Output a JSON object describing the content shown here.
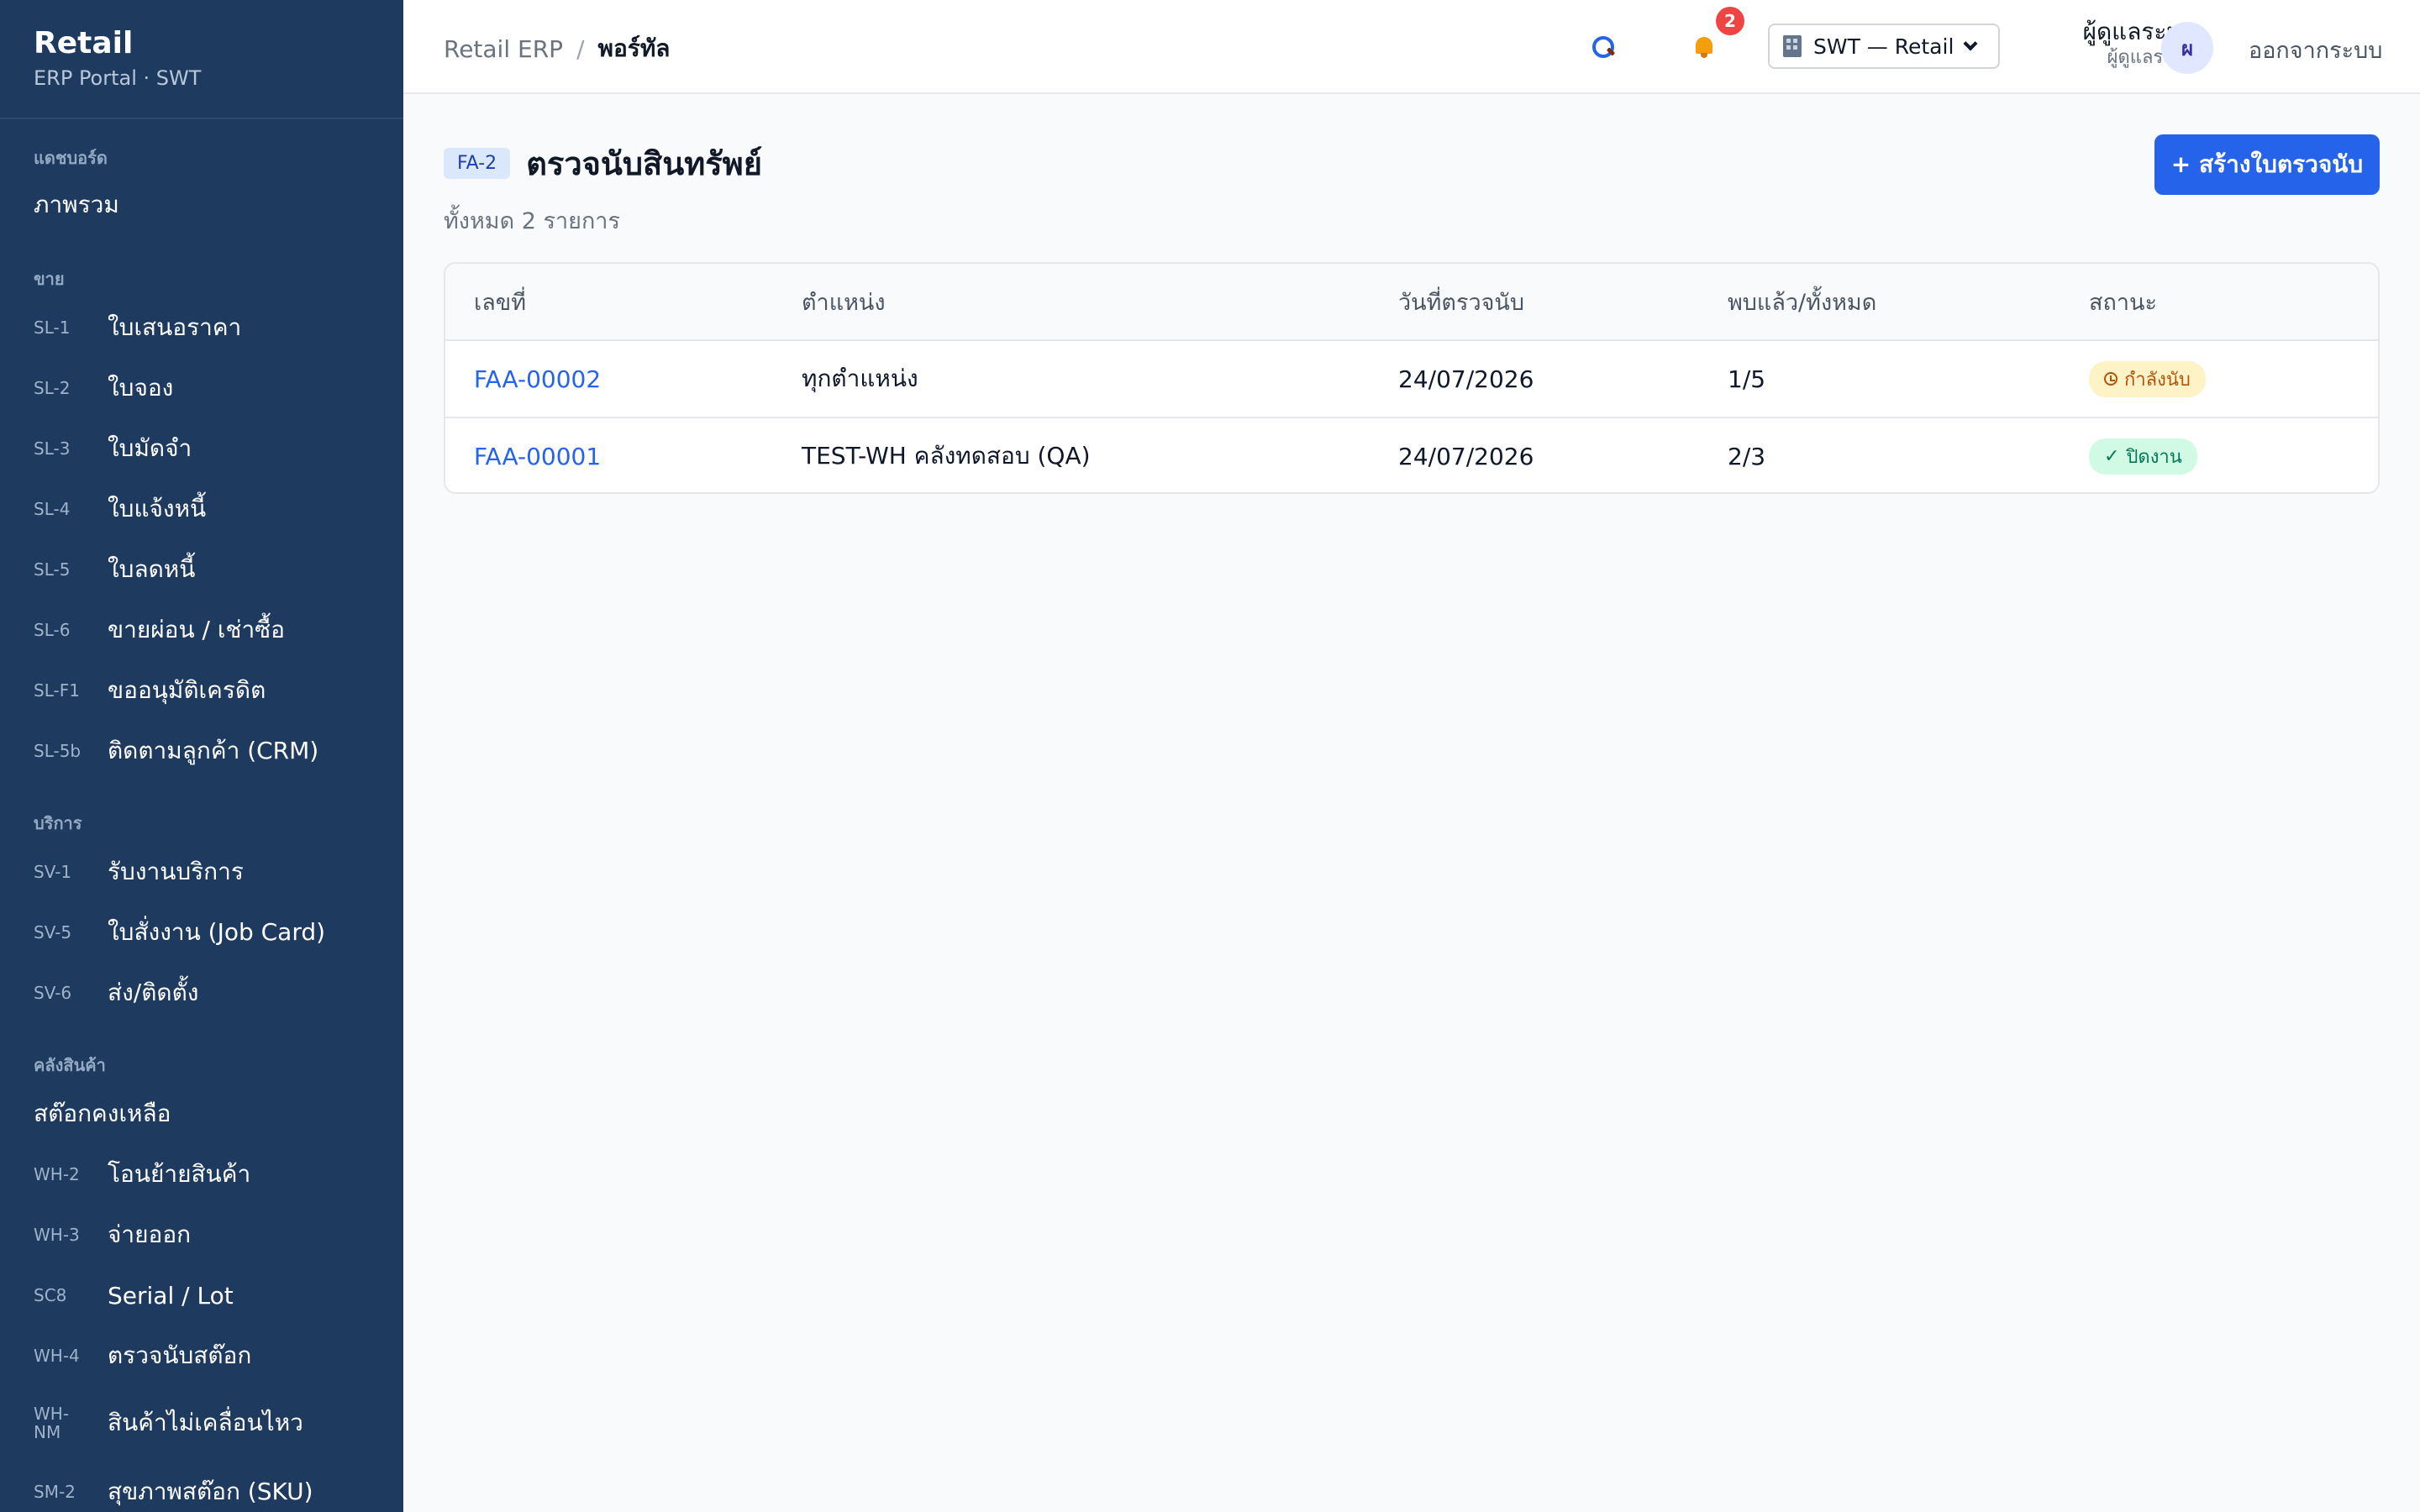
{
  "sidebar": {
    "brand_title": "Retail",
    "brand_subtitle": "ERP Portal · SWT",
    "sections": [
      {
        "title": "แดชบอร์ด",
        "items": [
          {
            "code": "",
            "label": "ภาพรวม"
          }
        ]
      },
      {
        "title": "ขาย",
        "items": [
          {
            "code": "SL-1",
            "label": "ใบเสนอราคา"
          },
          {
            "code": "SL-2",
            "label": "ใบจอง"
          },
          {
            "code": "SL-3",
            "label": "ใบมัดจำ"
          },
          {
            "code": "SL-4",
            "label": "ใบแจ้งหนี้"
          },
          {
            "code": "SL-5",
            "label": "ใบลดหนี้"
          },
          {
            "code": "SL-6",
            "label": "ขายผ่อน / เช่าซื้อ"
          },
          {
            "code": "SL-F1",
            "label": "ขออนุมัติเครดิต"
          },
          {
            "code": "SL-5b",
            "label": "ติดตามลูกค้า (CRM)"
          }
        ]
      },
      {
        "title": "บริการ",
        "items": [
          {
            "code": "SV-1",
            "label": "รับงานบริการ"
          },
          {
            "code": "SV-5",
            "label": "ใบสั่งงาน (Job Card)"
          },
          {
            "code": "SV-6",
            "label": "ส่ง/ติดตั้ง"
          }
        ]
      },
      {
        "title": "คลังสินค้า",
        "items": [
          {
            "code": "",
            "label": "สต๊อกคงเหลือ"
          },
          {
            "code": "WH-2",
            "label": "โอนย้ายสินค้า"
          },
          {
            "code": "WH-3",
            "label": "จ่ายออก"
          },
          {
            "code": "SC8",
            "label": "Serial / Lot"
          },
          {
            "code": "WH-4",
            "label": "ตรวจนับสต๊อก"
          },
          {
            "code": "WH-NM",
            "label": "สินค้าไม่เคลื่อนไหว"
          },
          {
            "code": "SM-2",
            "label": "สุขภาพสต๊อก (SKU)"
          }
        ]
      }
    ]
  },
  "topbar": {
    "breadcrumb_root": "Retail ERP",
    "breadcrumb_sep": "/",
    "breadcrumb_current": "พอร์ทัล",
    "search_icon": "search-icon",
    "bell_icon": "bell-icon",
    "notification_count": "2",
    "company_selector": "SWT — Retail",
    "user_name": "ผู้ดูแลระบบ",
    "user_role": "ผู้ดูแลระบบ",
    "avatar_initial": "ผ",
    "logout_label": "ออกจากระบบ"
  },
  "page": {
    "code": "FA-2",
    "title": "ตรวจนับสินทรัพย์",
    "subtitle": "ทั้งหมด 2 รายการ",
    "create_button": "+ สร้างใบตรวจนับ"
  },
  "table": {
    "columns": [
      "เลขที่",
      "ตำแหน่ง",
      "วันที่ตรวจนับ",
      "พบแล้ว/ทั้งหมด",
      "สถานะ"
    ],
    "rows": [
      {
        "doc_no": "FAA-00002",
        "location": "ทุกตำแหน่ง",
        "date": "24/07/2026",
        "found": "1/5",
        "status": "กำลังนับ",
        "status_color": "#b45309"
      },
      {
        "doc_no": "FAA-00001",
        "location": "TEST-WH คลังทดสอบ (QA)",
        "date": "24/07/2026",
        "found": "2/3",
        "status": "ปิดงาน",
        "status_color": "#047857"
      }
    ]
  },
  "colors": {
    "sidebar_bg": "#1e3a5f",
    "accent": "#2563eb",
    "badge": "#ef4444"
  }
}
